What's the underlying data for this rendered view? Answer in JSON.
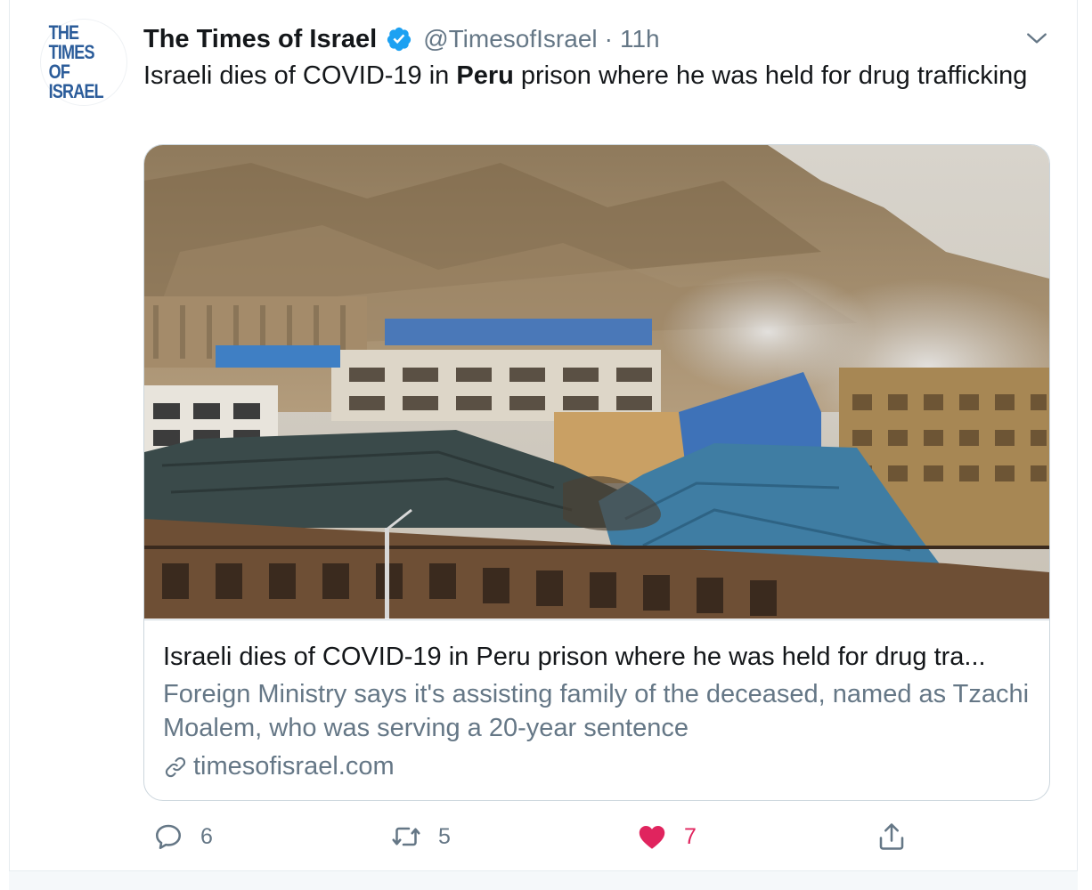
{
  "account": {
    "avatar_line1": "THE TIMES",
    "avatar_line2": "OF ISRAEL",
    "name": "The Times of Israel",
    "handle": "@TimesofIsrael",
    "separator": "·",
    "time": "11h"
  },
  "tweet": {
    "text_before": "Israeli dies of COVID-19 in ",
    "text_bold": "Peru",
    "text_after": " prison where he was held for drug trafficking"
  },
  "card": {
    "title": "Israeli dies of COVID-19 in Peru prison where he was held for drug tra...",
    "description": "Foreign Ministry says it's assisting family of the deceased, named as Tzachi Moalem, who was serving a 20-year sentence",
    "domain": "timesofisrael.com"
  },
  "actions": {
    "replies": "6",
    "retweets": "5",
    "likes": "7"
  },
  "colors": {
    "text": "#14171a",
    "secondary": "#657786",
    "verified": "#1da1f2",
    "like": "#e0245e",
    "border": "#ccd6dd"
  },
  "icons": [
    "verified-badge-icon",
    "chevron-down-icon",
    "link-icon",
    "reply-icon",
    "retweet-icon",
    "heart-icon",
    "share-icon"
  ]
}
